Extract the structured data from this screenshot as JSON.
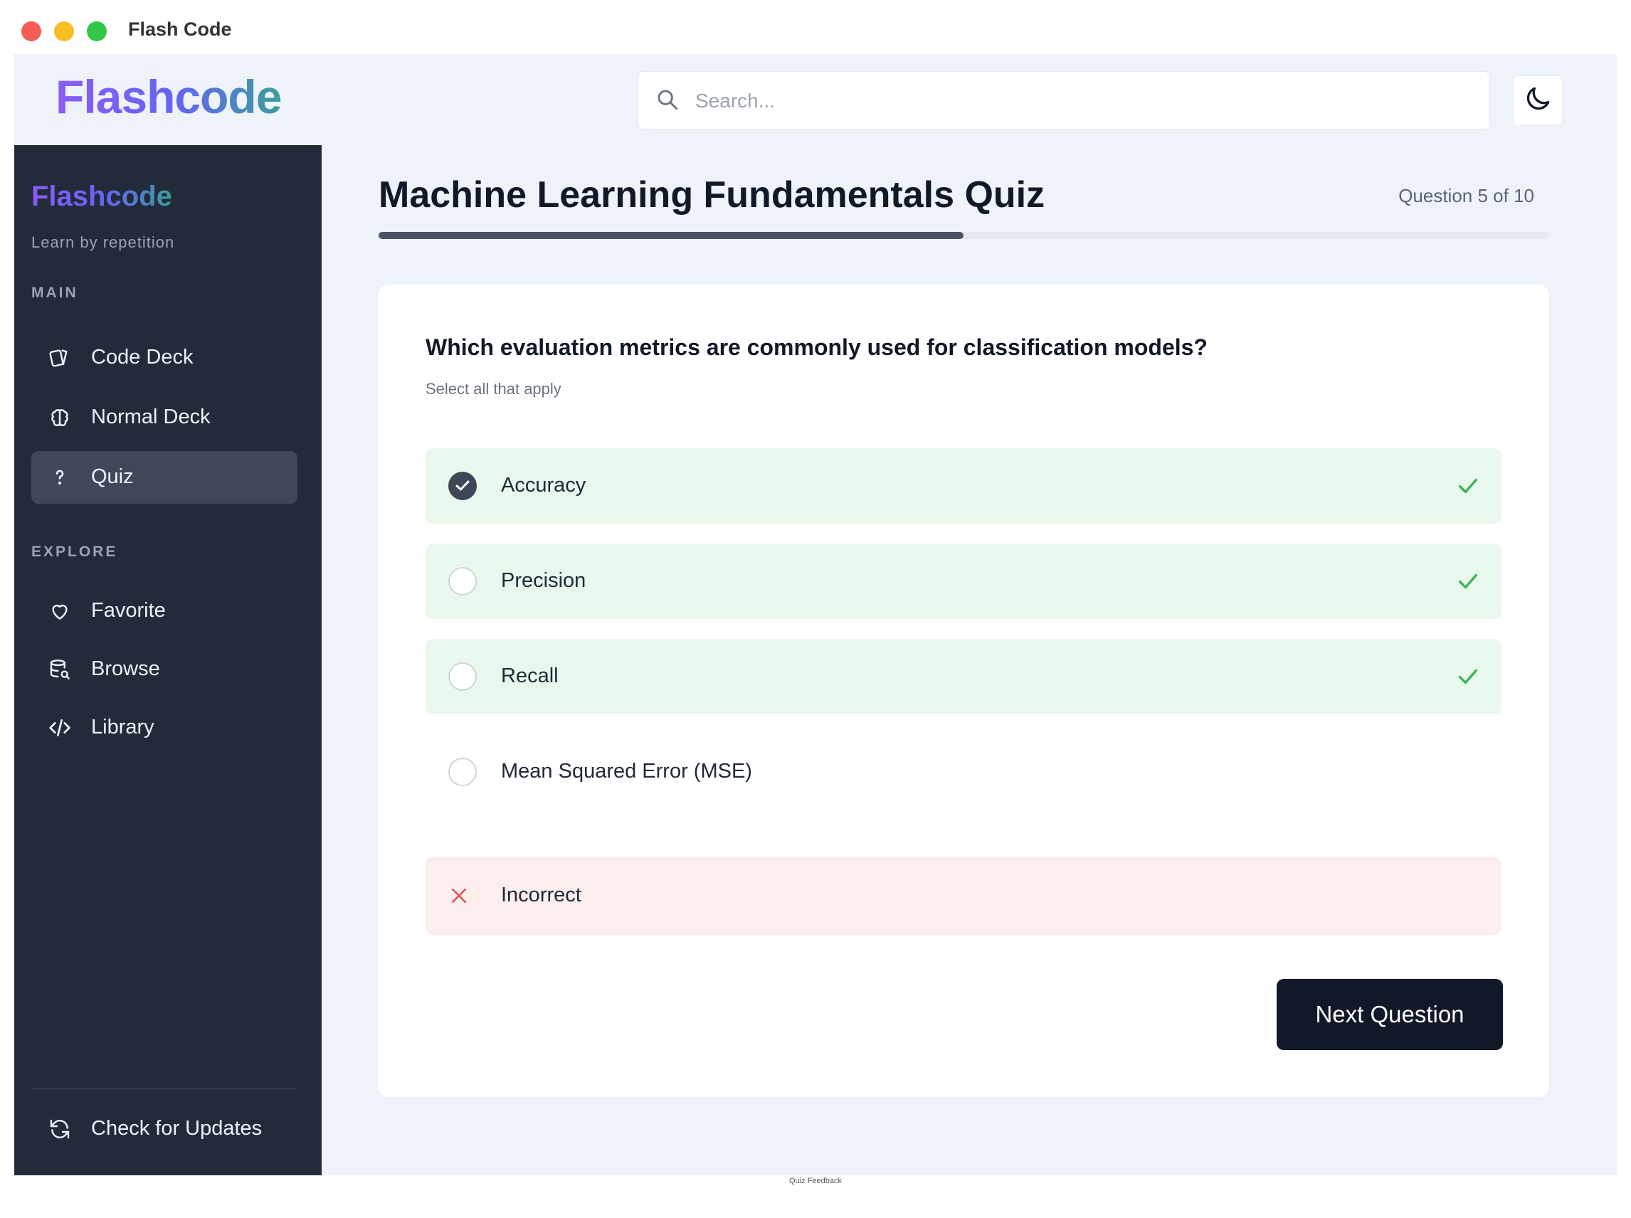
{
  "window": {
    "title": "Flash Code"
  },
  "header": {
    "brand": "Flashcode",
    "search_placeholder": "Search...",
    "theme_toggle_icon": "moon-icon"
  },
  "sidebar": {
    "brand": "Flashcode",
    "tagline": "Learn by repetition",
    "sections": [
      {
        "label": "MAIN"
      },
      {
        "label": "EXPLORE"
      }
    ],
    "items": [
      {
        "label": "Code Deck",
        "icon": "cards-icon",
        "active": false
      },
      {
        "label": "Normal Deck",
        "icon": "brain-icon",
        "active": false
      },
      {
        "label": "Quiz",
        "icon": "question-icon",
        "active": true
      },
      {
        "label": "Favorite",
        "icon": "heart-icon",
        "active": false
      },
      {
        "label": "Browse",
        "icon": "database-search-icon",
        "active": false
      },
      {
        "label": "Library",
        "icon": "code-icon",
        "active": false
      }
    ],
    "footer_item": {
      "label": "Check for Updates",
      "icon": "refresh-icon"
    }
  },
  "quiz": {
    "title": "Machine Learning Fundamentals Quiz",
    "counter": "Question 5 of 10",
    "progress": 0.5,
    "question": "Which evaluation metrics are commonly used for classification models?",
    "hint": "Select all that apply",
    "options": [
      {
        "label": "Accuracy",
        "checked": true,
        "correct": true
      },
      {
        "label": "Precision",
        "checked": false,
        "correct": true
      },
      {
        "label": "Recall",
        "checked": false,
        "correct": true
      },
      {
        "label": "Mean Squared Error (MSE)",
        "checked": false,
        "correct": false
      }
    ],
    "feedback": "Incorrect",
    "next_label": "Next Question"
  },
  "colors": {
    "sidebar_bg": "#232b3b",
    "correct_bg": "#e9f8ec",
    "correct_tick": "#3cb35a",
    "incorrect_bg": "#fdeeee",
    "incorrect_x": "#e25555",
    "button_bg": "#111827"
  },
  "footer_caption": "Quiz Feedback"
}
